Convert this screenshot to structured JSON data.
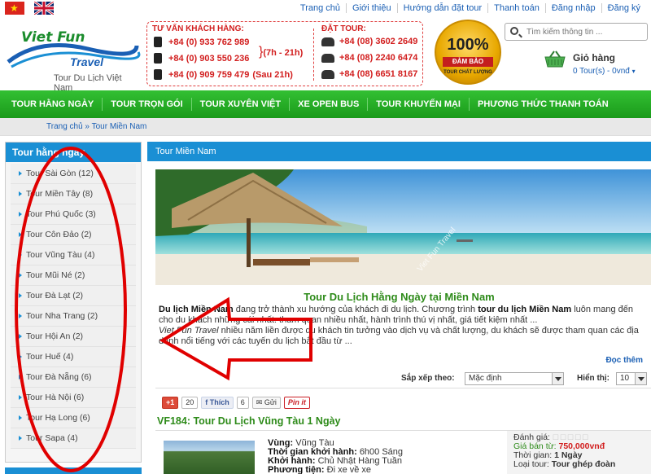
{
  "topnav": [
    "Trang chủ",
    "Giới thiệu",
    "Hướng dẫn đặt tour",
    "Thanh toán",
    "Đăng nhập",
    "Đăng ký"
  ],
  "logo": {
    "line1": "Viet Fun",
    "line2": "Travel",
    "tagline": "Tour Du Lịch Việt Nam"
  },
  "hotline": {
    "consult_title": "TƯ VẤN KHÁCH HÀNG:",
    "mobiles": [
      "+84 (0) 933 762 989",
      "+84 (0) 903 550 236",
      "+84 (0) 909 759 479"
    ],
    "hours": "(7h - 21h)",
    "after_hours": "(Sau 21h)",
    "booking_title": "ĐẶT TOUR:",
    "landlines": [
      "+84 (08) 3602 2649",
      "+84 (08) 2240 6474",
      "+84 (08) 6651 8167"
    ]
  },
  "badge": {
    "number": "100%",
    "band": "ĐẢM BẢO",
    "sub": "TOUR CHẤT LƯỢNG"
  },
  "search": {
    "placeholder": "Tìm kiếm thông tin ..."
  },
  "cart": {
    "label": "Giỏ hàng",
    "count": "0 Tour(s) - 0vnđ"
  },
  "mainnav": [
    "TOUR HẰNG NGÀY",
    "TOUR TRỌN GÓI",
    "TOUR XUYÊN VIỆT",
    "XE OPEN BUS",
    "TOUR KHUYẾN MẠI",
    "PHƯƠNG THỨC THANH TOÁN"
  ],
  "breadcrumb": "Trang chủ » Tour Miền Nam",
  "sidebar": {
    "title": "Tour hằng ngày",
    "items": [
      "Tour Sài Gòn (12)",
      "Tour Miền Tây (8)",
      "Tour Phú Quốc (3)",
      "Tour Côn Đảo (2)",
      "Tour Vũng Tàu (4)",
      "Tour Mũi Né (2)",
      "Tour Đà Lạt (2)",
      "Tour Nha Trang (2)",
      "Tour Hội An (2)",
      "Tour Huế (4)",
      "Tour Đà Nẵng (6)",
      "Tour Hà Nội (6)",
      "Tour Hạ Long (6)",
      "Tour Sapa (4)"
    ]
  },
  "content": {
    "title": "Tour Miền Nam",
    "article_title": "Tour Du Lịch Hằng Ngày tại Miền Nam",
    "p1_bold": "Du lịch Miền Nam",
    "p1_text": " đang trở thành xu hướng của khách đi du lịch. Chương trình ",
    "p1_bold2": "tour du lịch Miền Nam",
    "p1_text2": " luôn mang đến cho du khách những cái nhất: tham quan nhiều nhất, hành trình thú vị nhất, giá tiết kiệm nhất ...",
    "p2_italic": "Viet Fun Travel",
    "p2_text": " nhiều năm liền được du khách tin tưởng vào dịch vụ và chất lượng, du khách sẽ được tham quan các địa danh nổi tiếng với các tuyến du lịch bắt đầu từ ...",
    "more": "Đọc thêm",
    "sort_label": "Sắp xếp theo:",
    "sort_value": "Mặc định",
    "show_label": "Hiển thị:",
    "show_value": "10",
    "banner_watermark": "Viet Fun Travel"
  },
  "social": {
    "gplus": "+1",
    "gplus_count": "20",
    "fb": "Thích",
    "fb_count": "6",
    "send": "Gửi",
    "pin": "Pin it"
  },
  "tour": {
    "title": "VF184: Tour Du Lịch Vũng Tàu 1 Ngày",
    "area_label": "Vùng:",
    "area": "Vũng Tàu",
    "start_label": "Thời gian khởi hành:",
    "start": "6h00 Sáng",
    "depart_label": "Khởi hành:",
    "depart": "Chủ Nhật Hàng Tuần",
    "transport_label": "Phương tiện:",
    "transport": "Đi xe về xe",
    "rating_label": "Đánh giá:",
    "price_label": "Giá bán từ:",
    "price": "750,000vnđ",
    "duration_label": "Thời gian:",
    "duration": "1 Ngày",
    "type_label": "Loại tour:",
    "type": "Tour ghép đoàn"
  },
  "colors": {
    "nav_green": "#1a9a1a",
    "accent_blue": "#1a8fd4",
    "title_green": "#2e8b1a",
    "price_red": "#d21e1e",
    "annotation_red": "#e00000"
  }
}
